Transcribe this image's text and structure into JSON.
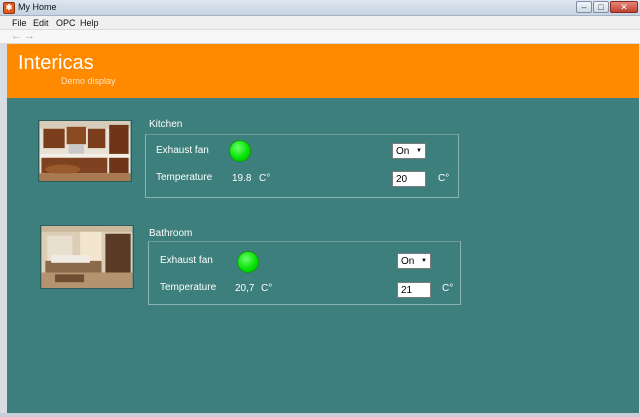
{
  "window": {
    "title": "My Home",
    "icon": "app-icon"
  },
  "menu": [
    "File",
    "Edit",
    "OPC",
    "Help"
  ],
  "toolbar": {
    "back": "←",
    "forward": "→"
  },
  "banner": {
    "title": "Intericas",
    "subtitle": "Demo display",
    "color": "#ff8a00"
  },
  "colors": {
    "background": "#3d7f7c",
    "fan_on": "#00e000"
  },
  "rooms": [
    {
      "name": "Kitchen",
      "fan_label": "Exhaust fan",
      "fan_state": "On",
      "temp_label": "Temperature",
      "temp_value": "19.8",
      "temp_unit": "C°",
      "setpoint": "20",
      "setpoint_unit": "C°"
    },
    {
      "name": "Bathroom",
      "fan_label": "Exhaust fan",
      "fan_state": "On",
      "temp_label": "Temperature",
      "temp_value": "20,7",
      "temp_unit": "C°",
      "setpoint": "21",
      "setpoint_unit": "C°"
    }
  ]
}
